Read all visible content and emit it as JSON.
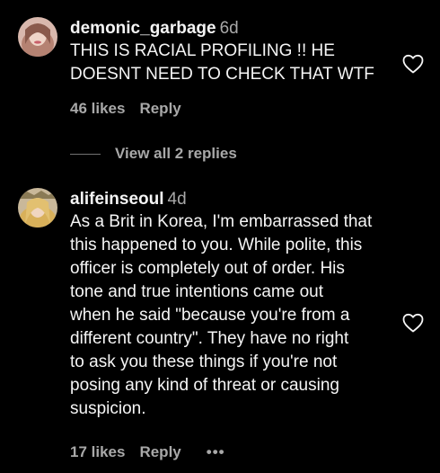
{
  "comments": [
    {
      "username": "demonic_garbage",
      "time": "6d",
      "text_lines": [
        "THIS IS RACIAL PROFILING !! HE",
        "DOESNT NEED TO CHECK THAT WTF"
      ],
      "likes": "46 likes",
      "reply_label": "Reply",
      "view_replies": "View all 2 replies"
    },
    {
      "username": "alifeinseoul",
      "time": "4d",
      "text_lines": [
        "As a Brit in Korea, I'm embarrassed that",
        "this happened to you. While polite, this",
        "officer is completely out of order. His",
        "tone and true intentions came out",
        "when he said \"because you're from a",
        "different country\". They have no right",
        "to ask you these things if you're not",
        "posing any kind of threat or causing",
        "suspicion."
      ],
      "likes": "17 likes",
      "reply_label": "Reply",
      "more_label": "•••"
    }
  ],
  "icons": {
    "like": "heart-outline-icon",
    "more": "more-options-icon"
  },
  "colors": {
    "background": "#000000",
    "primary_text": "#f5f5f5",
    "secondary_text": "#a8a8a8"
  }
}
